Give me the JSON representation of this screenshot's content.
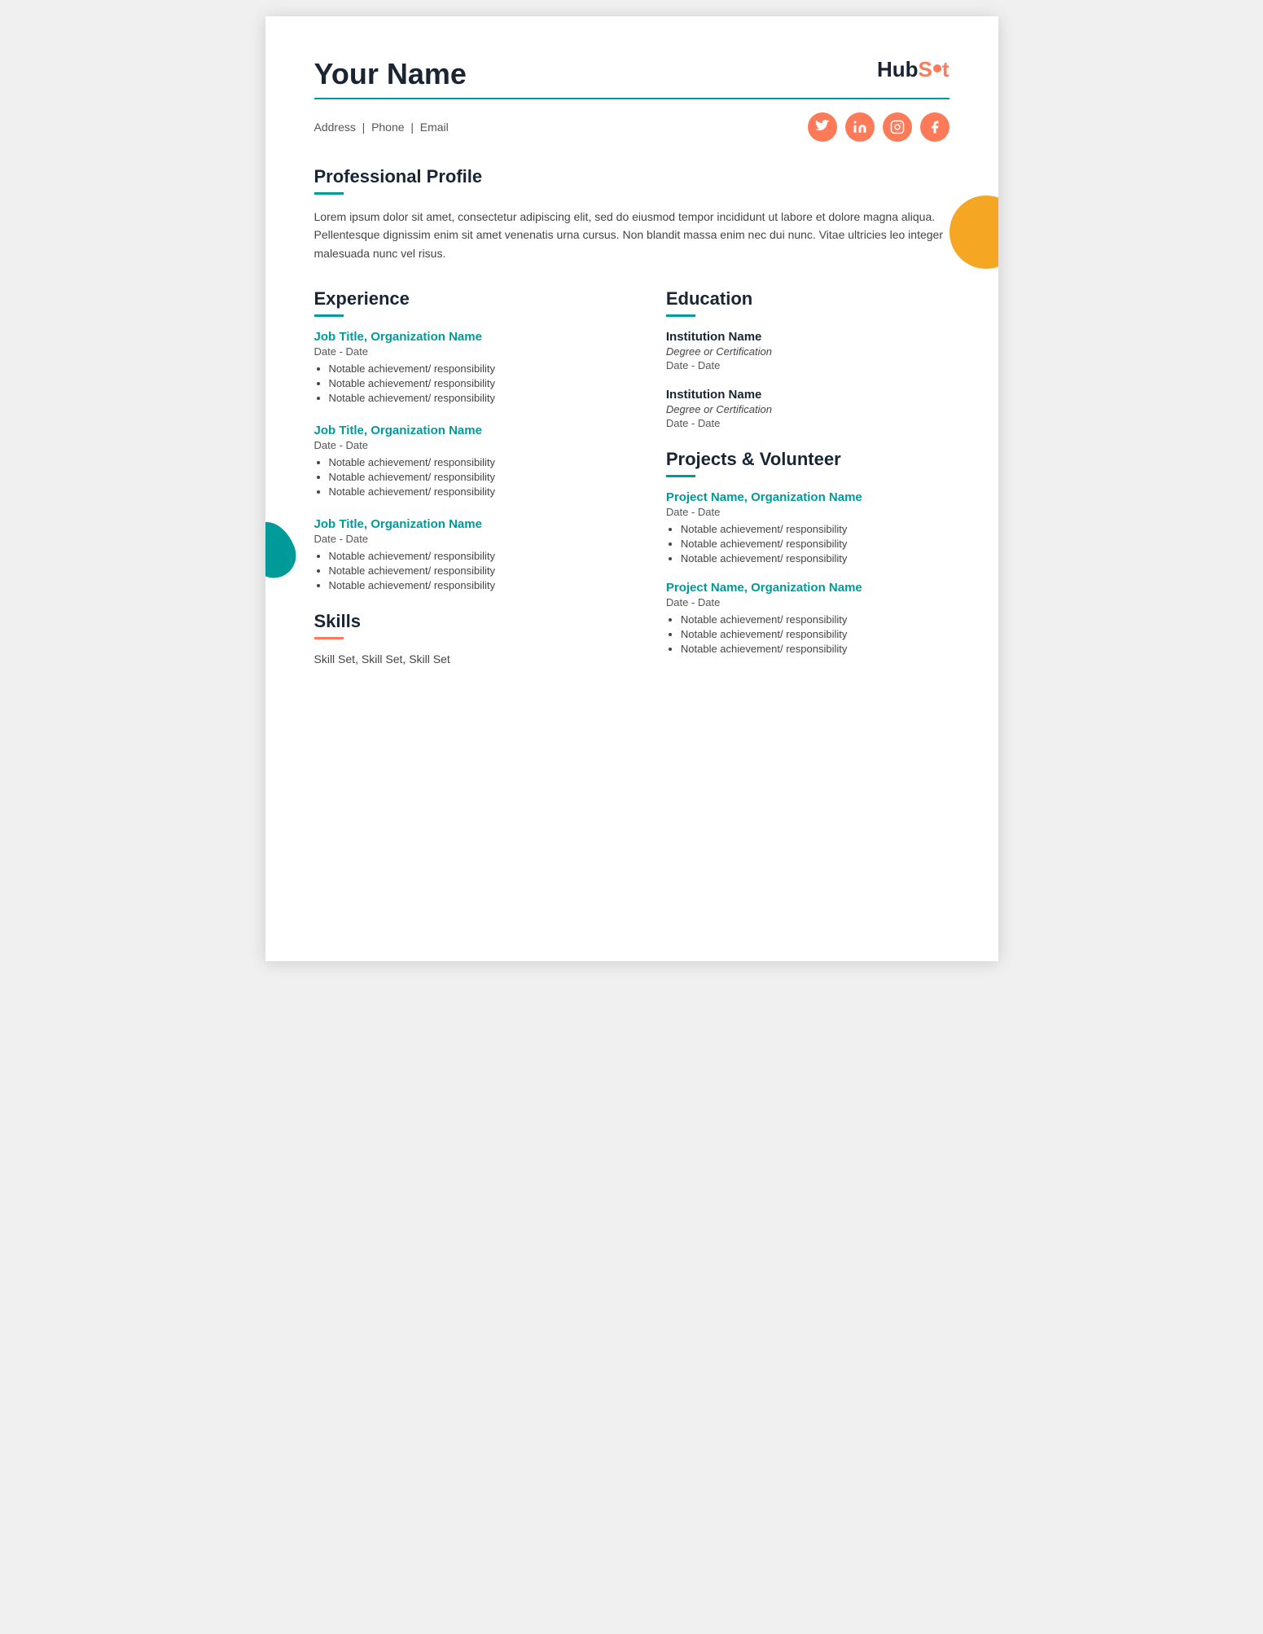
{
  "header": {
    "name": "Your Name",
    "logo_text_hub": "Hub",
    "logo_text_spot": "Sp",
    "logo_text_ot": "t"
  },
  "contact": {
    "address": "Address",
    "pipe1": "|",
    "phone": "Phone",
    "pipe2": "|",
    "email": "Email"
  },
  "social": {
    "icons": [
      "twitter",
      "linkedin",
      "instagram",
      "facebook"
    ]
  },
  "profile": {
    "section_title": "Professional Profile",
    "body": "Lorem ipsum dolor sit amet, consectetur adipiscing elit, sed do eiusmod tempor incididunt ut labore et dolore magna aliqua. Pellentesque dignissim enim sit amet venenatis urna cursus. Non blandit massa enim nec dui nunc. Vitae ultricies leo integer malesuada nunc vel risus."
  },
  "experience": {
    "section_title": "Experience",
    "jobs": [
      {
        "title": "Job Title, Organization Name",
        "date": "Date - Date",
        "bullets": [
          "Notable achievement/ responsibility",
          "Notable achievement/ responsibility",
          "Notable achievement/ responsibility"
        ]
      },
      {
        "title": "Job Title, Organization Name",
        "date": "Date - Date",
        "bullets": [
          "Notable achievement/ responsibility",
          "Notable achievement/ responsibility",
          "Notable achievement/ responsibility"
        ]
      },
      {
        "title": "Job Title, Organization Name",
        "date": "Date - Date",
        "bullets": [
          "Notable achievement/ responsibility",
          "Notable achievement/ responsibility",
          "Notable achievement/ responsibility"
        ]
      }
    ]
  },
  "skills": {
    "section_title": "Skills",
    "skill_list": "Skill Set, Skill Set, Skill Set"
  },
  "education": {
    "section_title": "Education",
    "entries": [
      {
        "institution": "Institution Name",
        "degree": "Degree or Certification",
        "date": "Date - Date"
      },
      {
        "institution": "Institution Name",
        "degree": "Degree or Certification",
        "date": "Date - Date"
      }
    ]
  },
  "projects": {
    "section_title": "Projects & Volunteer",
    "entries": [
      {
        "title": "Project Name, Organization Name",
        "date": "Date - Date",
        "bullets": [
          "Notable achievement/ responsibility",
          "Notable achievement/ responsibility",
          "Notable achievement/ responsibility"
        ]
      },
      {
        "title": "Project Name, Organization Name",
        "date": "Date - Date",
        "bullets": [
          "Notable achievement/ responsibility",
          "Notable achievement/ responsibility",
          "Notable achievement/ responsibility"
        ]
      }
    ]
  }
}
